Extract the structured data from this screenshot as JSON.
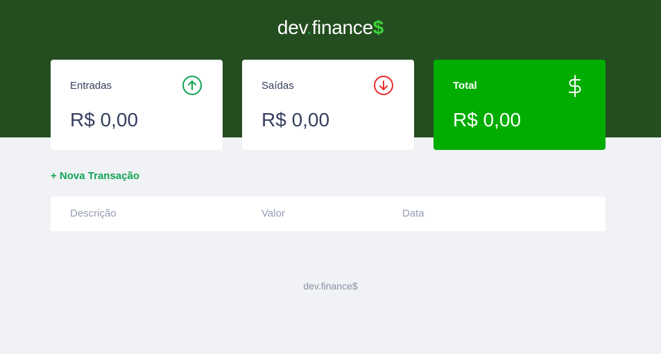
{
  "header": {
    "logo_part1": "dev",
    "logo_dot": ".",
    "logo_part2": "finance",
    "logo_dollar": "$"
  },
  "cards": [
    {
      "title": "Entradas",
      "value": "R$ 0,00",
      "icon": "arrow-up-circle-icon",
      "icon_color": "#12a454"
    },
    {
      "title": "Saídas",
      "value": "R$ 0,00",
      "icon": "arrow-down-circle-icon",
      "icon_color": "#e92929"
    },
    {
      "title": "Total",
      "value": "R$ 0,00",
      "icon": "dollar-icon",
      "icon_color": "#ffffff"
    }
  ],
  "actions": {
    "new_transaction": "+ Nova Transação"
  },
  "table": {
    "columns": [
      "Descrição",
      "Valor",
      "Data"
    ]
  },
  "footer": {
    "text": "dev.finance$"
  },
  "colors": {
    "header_bg": "#244d20",
    "total_card_bg": "#00ad00",
    "page_bg": "#f0f2f5",
    "accent_green": "#12a454"
  }
}
